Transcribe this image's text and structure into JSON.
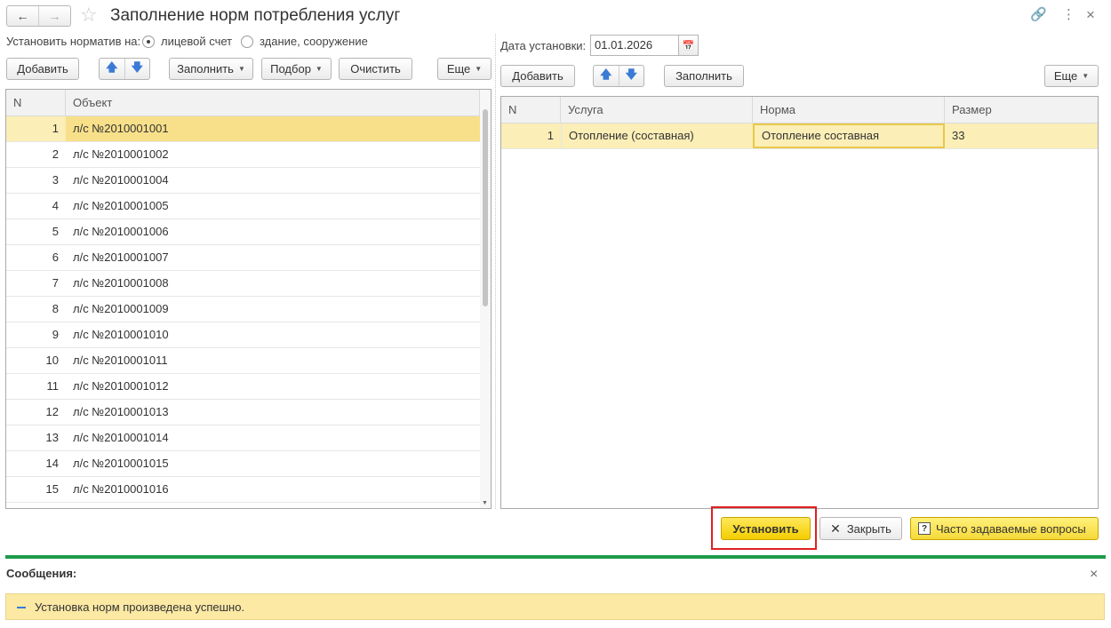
{
  "window": {
    "title": "Заполнение норм потребления услуг",
    "back_icon": "←",
    "forward_icon": "→",
    "star_icon": "☆",
    "link_icon": "🔗",
    "menu_icon": "⋮",
    "close_icon": "×"
  },
  "left_panel": {
    "standard_label": "Установить норматив на:",
    "radio_account": "лицевой счет",
    "radio_building": "здание, сооружение",
    "toolbar": {
      "add": "Добавить",
      "up": "🡅",
      "down": "🡇",
      "fill": "Заполнить",
      "pick": "Подбор",
      "clear": "Очистить",
      "more": "Еще"
    },
    "table": {
      "headers": {
        "n": "N",
        "object": "Объект"
      },
      "rows": [
        {
          "n": "1",
          "object": "л/с №2010001001"
        },
        {
          "n": "2",
          "object": "л/с №2010001002"
        },
        {
          "n": "3",
          "object": "л/с №2010001004"
        },
        {
          "n": "4",
          "object": "л/с №2010001005"
        },
        {
          "n": "5",
          "object": "л/с №2010001006"
        },
        {
          "n": "6",
          "object": "л/с №2010001007"
        },
        {
          "n": "7",
          "object": "л/с №2010001008"
        },
        {
          "n": "8",
          "object": "л/с №2010001009"
        },
        {
          "n": "9",
          "object": "л/с №2010001010"
        },
        {
          "n": "10",
          "object": "л/с №2010001011"
        },
        {
          "n": "11",
          "object": "л/с №2010001012"
        },
        {
          "n": "12",
          "object": "л/с №2010001013"
        },
        {
          "n": "13",
          "object": "л/с №2010001014"
        },
        {
          "n": "14",
          "object": "л/с №2010001015"
        },
        {
          "n": "15",
          "object": "л/с №2010001016"
        }
      ]
    }
  },
  "right_panel": {
    "date_label": "Дата установки:",
    "date_value": "01.01.2026",
    "calendar_icon": "📅",
    "toolbar": {
      "add": "Добавить",
      "up": "🡅",
      "down": "🡇",
      "fill": "Заполнить",
      "more": "Еще"
    },
    "table": {
      "headers": {
        "n": "N",
        "service": "Услуга",
        "norm": "Норма",
        "size": "Размер"
      },
      "rows": [
        {
          "n": "1",
          "service": "Отопление (составная)",
          "norm": "Отопление составная",
          "size": "33"
        }
      ]
    }
  },
  "footer_buttons": {
    "set": "Установить",
    "close": "Закрыть",
    "close_icon": "✕",
    "faq": "Часто задаваемые вопросы",
    "faq_icon": "?"
  },
  "messages": {
    "title": "Сообщения:",
    "close_icon": "×",
    "items": [
      {
        "text": "Установка норм произведена успешно."
      }
    ]
  }
}
